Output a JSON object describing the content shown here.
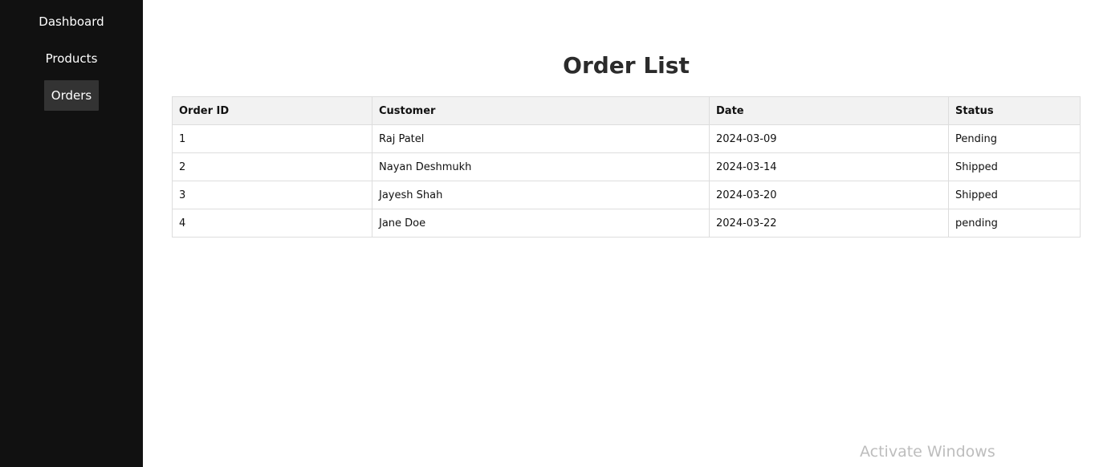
{
  "sidebar": {
    "items": [
      {
        "label": "Dashboard",
        "active": false
      },
      {
        "label": "Products",
        "active": false
      },
      {
        "label": "Orders",
        "active": true
      }
    ]
  },
  "main": {
    "title": "Order List",
    "table": {
      "headers": [
        "Order ID",
        "Customer",
        "Date",
        "Status"
      ],
      "rows": [
        [
          "1",
          "Raj Patel",
          "2024-03-09",
          "Pending"
        ],
        [
          "2",
          "Nayan Deshmukh",
          "2024-03-14",
          "Shipped"
        ],
        [
          "3",
          "Jayesh Shah",
          "2024-03-20",
          "Shipped"
        ],
        [
          "4",
          "Jane Doe",
          "2024-03-22",
          "pending"
        ]
      ]
    }
  },
  "watermark": {
    "text": "Activate Windows"
  },
  "colors": {
    "sidebar_bg": "#111111",
    "active_item_bg": "#333333",
    "header_bg": "#f2f2f2"
  }
}
